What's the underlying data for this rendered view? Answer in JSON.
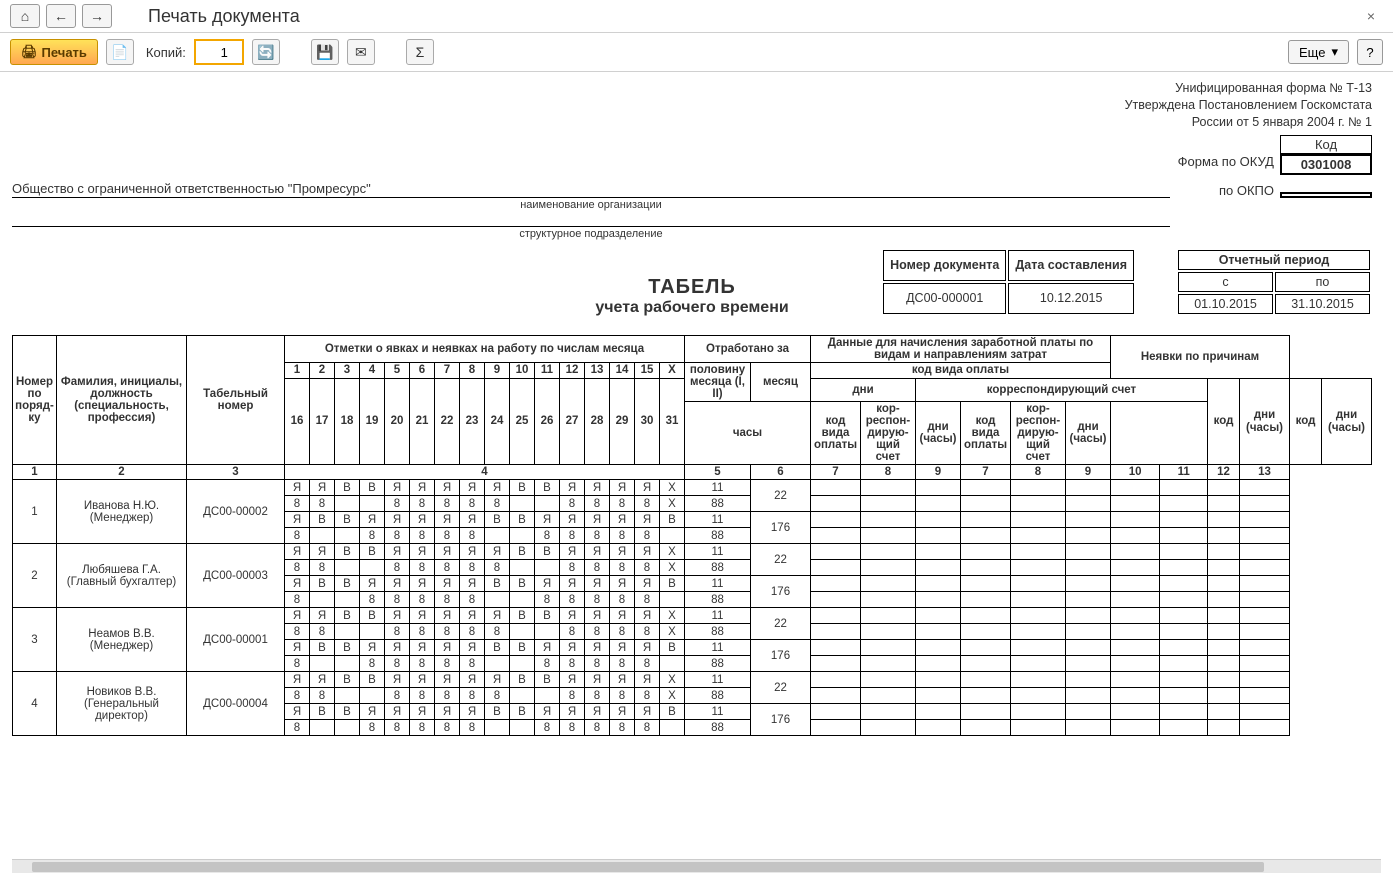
{
  "nav": {
    "home": "⌂",
    "back": "←",
    "fwd": "→"
  },
  "page": {
    "title": "Печать документа",
    "close": "×"
  },
  "toolbar": {
    "print_label": "Печать",
    "copies_label": "Копий:",
    "copies_value": "1",
    "more_label": "Еще",
    "help": "?",
    "sigma": "Σ"
  },
  "form_header": {
    "line1": "Унифицированная форма № Т-13",
    "line2": "Утверждена Постановлением Госкомстата",
    "line3": "России от 5 января 2004 г. № 1"
  },
  "codes": {
    "kod_label": "Код",
    "okud_label": "Форма по ОКУД",
    "okud_value": "0301008",
    "okpo_label": "по ОКПО",
    "okpo_value": ""
  },
  "org": {
    "name": "Общество с ограниченной ответственностью \"Промресурс\"",
    "sub1": "наименование организации",
    "sub2": "структурное подразделение"
  },
  "meta": {
    "docnum_label": "Номер документа",
    "docnum_value": "ДС00-000001",
    "date_label": "Дата составления",
    "date_value": "10.12.2015",
    "period_label": "Отчетный период",
    "from_label": "с",
    "to_label": "по",
    "from_value": "01.10.2015",
    "to_value": "31.10.2015"
  },
  "title": {
    "main": "ТАБЕЛЬ",
    "sub": "учета  рабочего времени"
  },
  "headers": {
    "num": "Номер по поряд-ку",
    "fio": "Фамилия, инициалы, должность (специальность, профессия)",
    "tabnum": "Табельный номер",
    "marks": "Отметки о явках и неявках на работу по числам месяца",
    "worked": "Отработано за",
    "half": "половину месяца (I, II)",
    "month": "месяц",
    "days": "дни",
    "hours": "часы",
    "payment": "Данные для начисления заработной платы по видам и направлениям затрат",
    "paycode": "код вида оплаты",
    "account": "корреспондирующий счет",
    "p1": "код вида оплаты",
    "p2": "кор-респон-дирую-щий счет",
    "p3": "дни (часы)",
    "absences": "Неявки по причинам",
    "code": "код",
    "dayshours": "дни (часы)"
  },
  "day_labels_top": [
    "1",
    "2",
    "3",
    "4",
    "5",
    "6",
    "7",
    "8",
    "9",
    "10",
    "11",
    "12",
    "13",
    "14",
    "15",
    "Х"
  ],
  "day_labels_bot": [
    "16",
    "17",
    "18",
    "19",
    "20",
    "21",
    "22",
    "23",
    "24",
    "25",
    "26",
    "27",
    "28",
    "29",
    "30",
    "31"
  ],
  "col_nums": [
    "1",
    "2",
    "3",
    "4",
    "5",
    "6",
    "7",
    "8",
    "9",
    "7",
    "8",
    "9",
    "10",
    "11",
    "12",
    "13"
  ],
  "rows": [
    {
      "n": "1",
      "fio": "Иванова Н.Ю. (Менеджер)",
      "tab": "ДС00-00002",
      "r1": [
        "Я",
        "Я",
        "В",
        "В",
        "Я",
        "Я",
        "Я",
        "Я",
        "Я",
        "В",
        "В",
        "Я",
        "Я",
        "Я",
        "Я",
        "Х"
      ],
      "h1": [
        "8",
        "8",
        "",
        "",
        "8",
        "8",
        "8",
        "8",
        "8",
        "",
        "",
        "8",
        "8",
        "8",
        "8",
        "Х"
      ],
      "r2": [
        "Я",
        "В",
        "В",
        "Я",
        "Я",
        "Я",
        "Я",
        "Я",
        "В",
        "В",
        "Я",
        "Я",
        "Я",
        "Я",
        "Я",
        "В"
      ],
      "h2": [
        "8",
        "",
        "",
        "8",
        "8",
        "8",
        "8",
        "8",
        "",
        "",
        "8",
        "8",
        "8",
        "8",
        "8",
        ""
      ],
      "days1": "11",
      "hours1": "88",
      "days2": "11",
      "hours2": "88",
      "half": "22",
      "month": "176"
    },
    {
      "n": "2",
      "fio": "Любяшева Г.А. (Главный бухгалтер)",
      "tab": "ДС00-00003",
      "r1": [
        "Я",
        "Я",
        "В",
        "В",
        "Я",
        "Я",
        "Я",
        "Я",
        "Я",
        "В",
        "В",
        "Я",
        "Я",
        "Я",
        "Я",
        "Х"
      ],
      "h1": [
        "8",
        "8",
        "",
        "",
        "8",
        "8",
        "8",
        "8",
        "8",
        "",
        "",
        "8",
        "8",
        "8",
        "8",
        "Х"
      ],
      "r2": [
        "Я",
        "В",
        "В",
        "Я",
        "Я",
        "Я",
        "Я",
        "Я",
        "В",
        "В",
        "Я",
        "Я",
        "Я",
        "Я",
        "Я",
        "В"
      ],
      "h2": [
        "8",
        "",
        "",
        "8",
        "8",
        "8",
        "8",
        "8",
        "",
        "",
        "8",
        "8",
        "8",
        "8",
        "8",
        ""
      ],
      "days1": "11",
      "hours1": "88",
      "days2": "11",
      "hours2": "88",
      "half": "22",
      "month": "176"
    },
    {
      "n": "3",
      "fio": "Неамов В.В. (Менеджер)",
      "tab": "ДС00-00001",
      "r1": [
        "Я",
        "Я",
        "В",
        "В",
        "Я",
        "Я",
        "Я",
        "Я",
        "Я",
        "В",
        "В",
        "Я",
        "Я",
        "Я",
        "Я",
        "Х"
      ],
      "h1": [
        "8",
        "8",
        "",
        "",
        "8",
        "8",
        "8",
        "8",
        "8",
        "",
        "",
        "8",
        "8",
        "8",
        "8",
        "Х"
      ],
      "r2": [
        "Я",
        "В",
        "В",
        "Я",
        "Я",
        "Я",
        "Я",
        "Я",
        "В",
        "В",
        "Я",
        "Я",
        "Я",
        "Я",
        "Я",
        "В"
      ],
      "h2": [
        "8",
        "",
        "",
        "8",
        "8",
        "8",
        "8",
        "8",
        "",
        "",
        "8",
        "8",
        "8",
        "8",
        "8",
        ""
      ],
      "days1": "11",
      "hours1": "88",
      "days2": "11",
      "hours2": "88",
      "half": "22",
      "month": "176"
    },
    {
      "n": "4",
      "fio": "Новиков В.В. (Генеральный директор)",
      "tab": "ДС00-00004",
      "r1": [
        "Я",
        "Я",
        "В",
        "В",
        "Я",
        "Я",
        "Я",
        "Я",
        "Я",
        "В",
        "В",
        "Я",
        "Я",
        "Я",
        "Я",
        "Х"
      ],
      "h1": [
        "8",
        "8",
        "",
        "",
        "8",
        "8",
        "8",
        "8",
        "8",
        "",
        "",
        "8",
        "8",
        "8",
        "8",
        "Х"
      ],
      "r2": [
        "Я",
        "В",
        "В",
        "Я",
        "Я",
        "Я",
        "Я",
        "Я",
        "В",
        "В",
        "Я",
        "Я",
        "Я",
        "Я",
        "Я",
        "В"
      ],
      "h2": [
        "8",
        "",
        "",
        "8",
        "8",
        "8",
        "8",
        "8",
        "",
        "",
        "8",
        "8",
        "8",
        "8",
        "8",
        ""
      ],
      "days1": "11",
      "hours1": "88",
      "days2": "11",
      "hours2": "88",
      "half": "22",
      "month": "176"
    }
  ]
}
